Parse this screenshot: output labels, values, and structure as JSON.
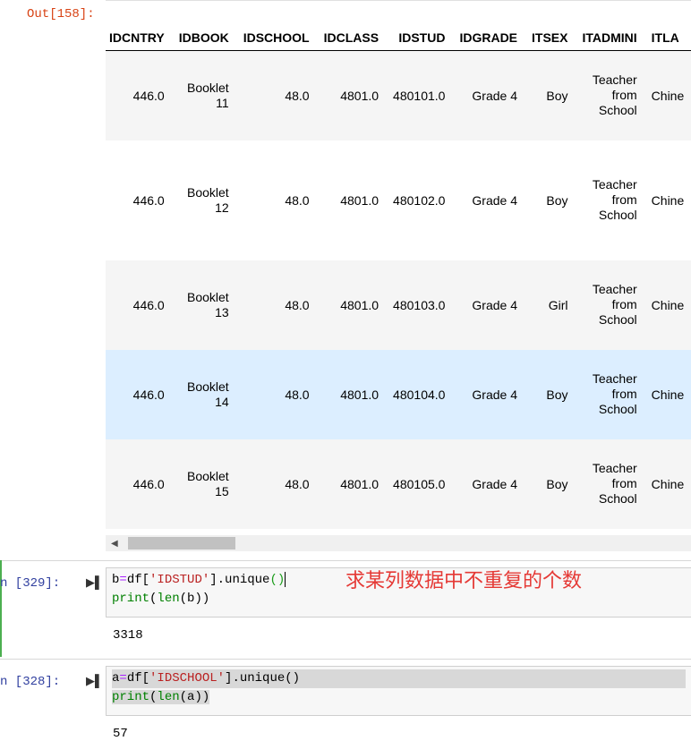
{
  "output_prompt": "Out[158]:",
  "table": {
    "columns": [
      "IDCNTRY",
      "IDBOOK",
      "IDSCHOOL",
      "IDCLASS",
      "IDSTUD",
      "IDGRADE",
      "ITSEX",
      "ITADMINI",
      "ITLA"
    ],
    "rows": [
      {
        "cntry": "446.0",
        "book_word": "Booklet",
        "book_num": "11",
        "school": "48.0",
        "class": "4801.0",
        "stud": "480101.0",
        "grade": "Grade 4",
        "sex": "Boy",
        "admin_1": "Teacher",
        "admin_2": "from",
        "admin_3": "School",
        "lang": "Chine"
      },
      {
        "cntry": "446.0",
        "book_word": "Booklet",
        "book_num": "12",
        "school": "48.0",
        "class": "4801.0",
        "stud": "480102.0",
        "grade": "Grade 4",
        "sex": "Boy",
        "admin_1": "Teacher",
        "admin_2": "from",
        "admin_3": "School",
        "lang": "Chine"
      },
      {
        "cntry": "446.0",
        "book_word": "Booklet",
        "book_num": "13",
        "school": "48.0",
        "class": "4801.0",
        "stud": "480103.0",
        "grade": "Grade 4",
        "sex": "Girl",
        "admin_1": "Teacher",
        "admin_2": "from",
        "admin_3": "School",
        "lang": "Chine"
      },
      {
        "cntry": "446.0",
        "book_word": "Booklet",
        "book_num": "14",
        "school": "48.0",
        "class": "4801.0",
        "stud": "480104.0",
        "grade": "Grade 4",
        "sex": "Boy",
        "admin_1": "Teacher",
        "admin_2": "from",
        "admin_3": "School",
        "lang": "Chine"
      },
      {
        "cntry": "446.0",
        "book_word": "Booklet",
        "book_num": "15",
        "school": "48.0",
        "class": "4801.0",
        "stud": "480105.0",
        "grade": "Grade 4",
        "sex": "Boy",
        "admin_1": "Teacher",
        "admin_2": "from",
        "admin_3": "School",
        "lang": "Chine"
      }
    ]
  },
  "cells": [
    {
      "prompt": "n  [329]:",
      "code_line1": {
        "var": "b",
        "eq": "=",
        "df": "df[",
        "str": "'IDSTUD'",
        "rest": "].unique",
        "po": "(",
        "pc": ")"
      },
      "code_line2": {
        "fn": "print",
        "o1": "(",
        "fn2": "len",
        "o2": "(b))"
      },
      "output": "3318",
      "annotation": "求某列数据中不重复的个数"
    },
    {
      "prompt": "n  [328]:",
      "code_line1": {
        "var": "a",
        "eq": "=",
        "df": "df[",
        "str": "'IDSCHOOL'",
        "rest": "].unique",
        "po": "(",
        "pc": ")"
      },
      "code_line2": {
        "fn": "print",
        "o1": "(",
        "fn2": "len",
        "o2": "(a))"
      },
      "output": "57"
    }
  ],
  "icons": {
    "run": "run-cell-icon",
    "scroll_left": "scroll-left-arrow-icon"
  },
  "colors": {
    "accent_hover_row": "#dceeff",
    "annotation": "#e53935",
    "prompt_out": "#d84315",
    "prompt_in": "#303f9f"
  }
}
